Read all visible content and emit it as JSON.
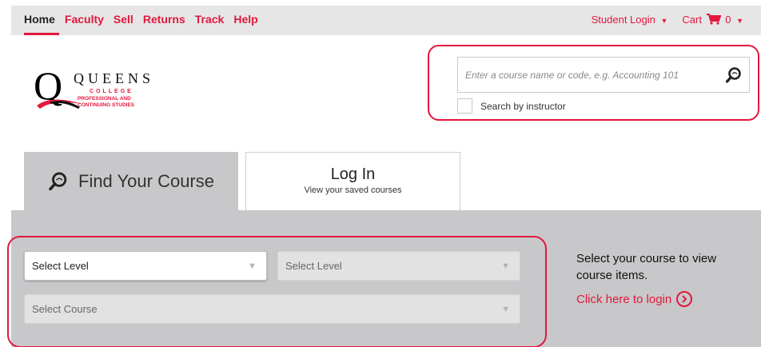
{
  "nav": {
    "links": [
      "Home",
      "Faculty",
      "Sell",
      "Returns",
      "Track",
      "Help"
    ],
    "student_login": "Student Login",
    "cart_label": "Cart",
    "cart_count": "0",
    "caret": "▼"
  },
  "logo": {
    "letter": "Q",
    "name": "QUEENS",
    "college": "COLLEGE",
    "subtitle_line1": "PROFESSIONAL AND",
    "subtitle_line2": "CONTINUING STUDIES"
  },
  "search": {
    "placeholder": "Enter a course name or code, e.g. Accounting 101",
    "instructor_label": "Search by instructor",
    "icon": "search-icon"
  },
  "tabs": {
    "find_label": "Find Your Course",
    "login_title": "Log In",
    "login_subtitle": "View your saved courses"
  },
  "selects": {
    "level_1": "Select Level",
    "level_2": "Select Level",
    "course": "Select Course",
    "arrow": "▼"
  },
  "side": {
    "prompt": "Select your course to view course items.",
    "login_link": "Click here to login"
  },
  "colors": {
    "accent": "#e3183d",
    "panel": "#c8c8ca",
    "nav_bg": "#e6e6e6"
  }
}
